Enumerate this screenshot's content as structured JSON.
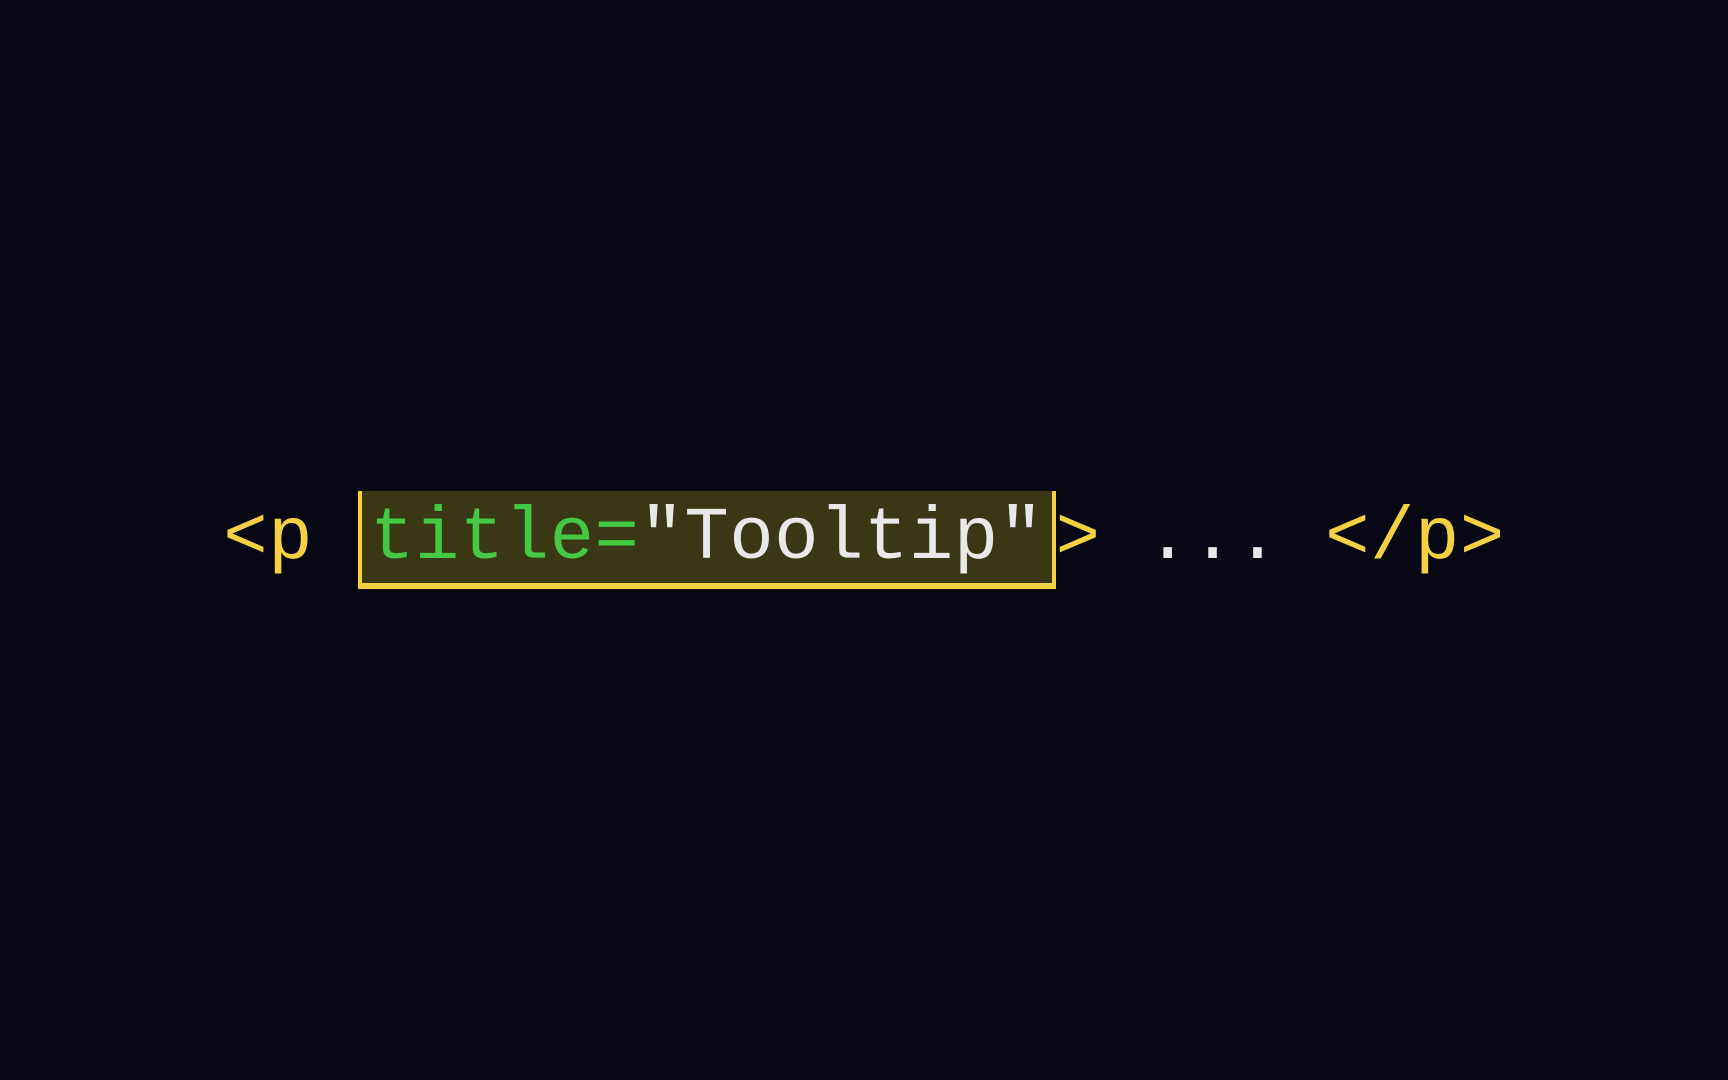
{
  "code": {
    "open_tag_start": "<p ",
    "attribute_name": "title",
    "equals": "=",
    "quote_open": "\"",
    "attribute_value": "Tooltip",
    "quote_close": "\"",
    "open_tag_end": ">",
    "content": " ... ",
    "close_tag": "</p>"
  }
}
